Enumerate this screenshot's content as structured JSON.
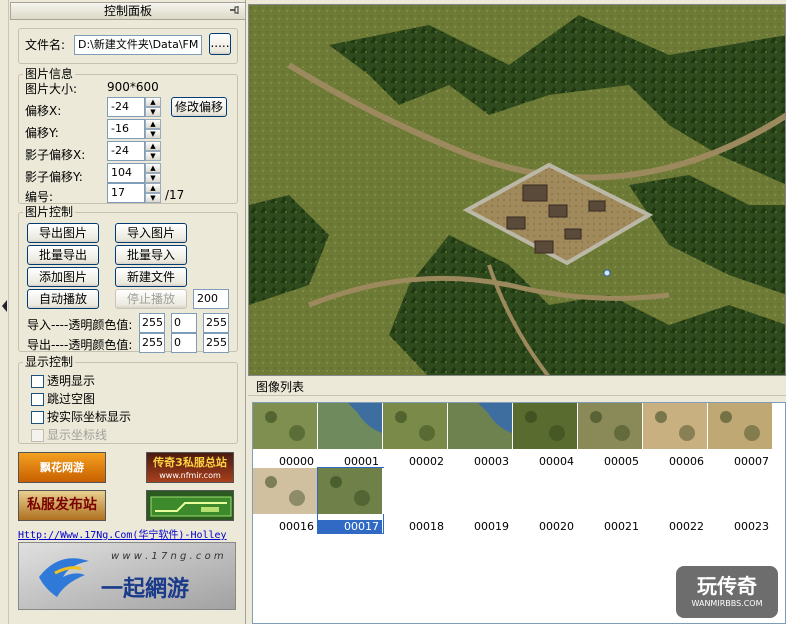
{
  "panel": {
    "title": "控制面板",
    "file_label": "文件名:",
    "file_value": "D:\\新建文件夹\\Data\\FM",
    "browse_label": ".....",
    "info_group": "图片信息",
    "size_label": "图片大小:",
    "size_value": "900*600",
    "offset_x_label": "偏移X:",
    "offset_x": "-24",
    "offset_y_label": "偏移Y:",
    "offset_y": "-16",
    "shadow_x_label": "影子偏移X:",
    "shadow_x": "-24",
    "shadow_y_label": "影子偏移Y:",
    "shadow_y": "104",
    "index_label": "编号:",
    "index_value": "17",
    "index_total": "/17",
    "modify_offset": "修改偏移",
    "control_group": "图片控制",
    "export_image": "导出图片",
    "import_image": "导入图片",
    "batch_export": "批量导出",
    "batch_import": "批量导入",
    "add_image": "添加图片",
    "new_file": "新建文件",
    "auto_play": "自动播放",
    "stop_play": "停止播放",
    "play_interval": "200",
    "import_color_label": "导入----透明颜色值:",
    "import_color": [
      "255",
      "0",
      "255"
    ],
    "export_color_label": "导出----透明颜色值:",
    "export_color": [
      "255",
      "0",
      "255"
    ],
    "display_group": "显示控制",
    "opt_transparent": "透明显示",
    "opt_skip_empty": "跳过空图",
    "opt_actual_coords": "按实际坐标显示",
    "opt_show_axes": "显示坐标线",
    "banner1": "飘花网游",
    "banner2": "传奇3私服总站",
    "banner2_sub": "www.nfmir.com",
    "banner3": "私服发布站",
    "link_text": "Http://Www.17Ng.Com(华宁软件)-Holley",
    "logo_url": "w w w . 1 7 n g . c o m",
    "logo_text": "一起網游"
  },
  "list": {
    "header": "图像列表",
    "thumbs": [
      "00000",
      "00001",
      "00002",
      "00003",
      "00004",
      "00005",
      "00006",
      "00007",
      "00016",
      "00017",
      "00018",
      "00019",
      "00020",
      "00021",
      "00022",
      "00023"
    ],
    "selected": "00017"
  },
  "watermark": {
    "title": "玩传奇",
    "sub": "WANMIRBBS.COM"
  },
  "colors": {
    "selection": "#316ac5",
    "panel_bg": "#ece9d8",
    "grass": "#6d7a35"
  }
}
